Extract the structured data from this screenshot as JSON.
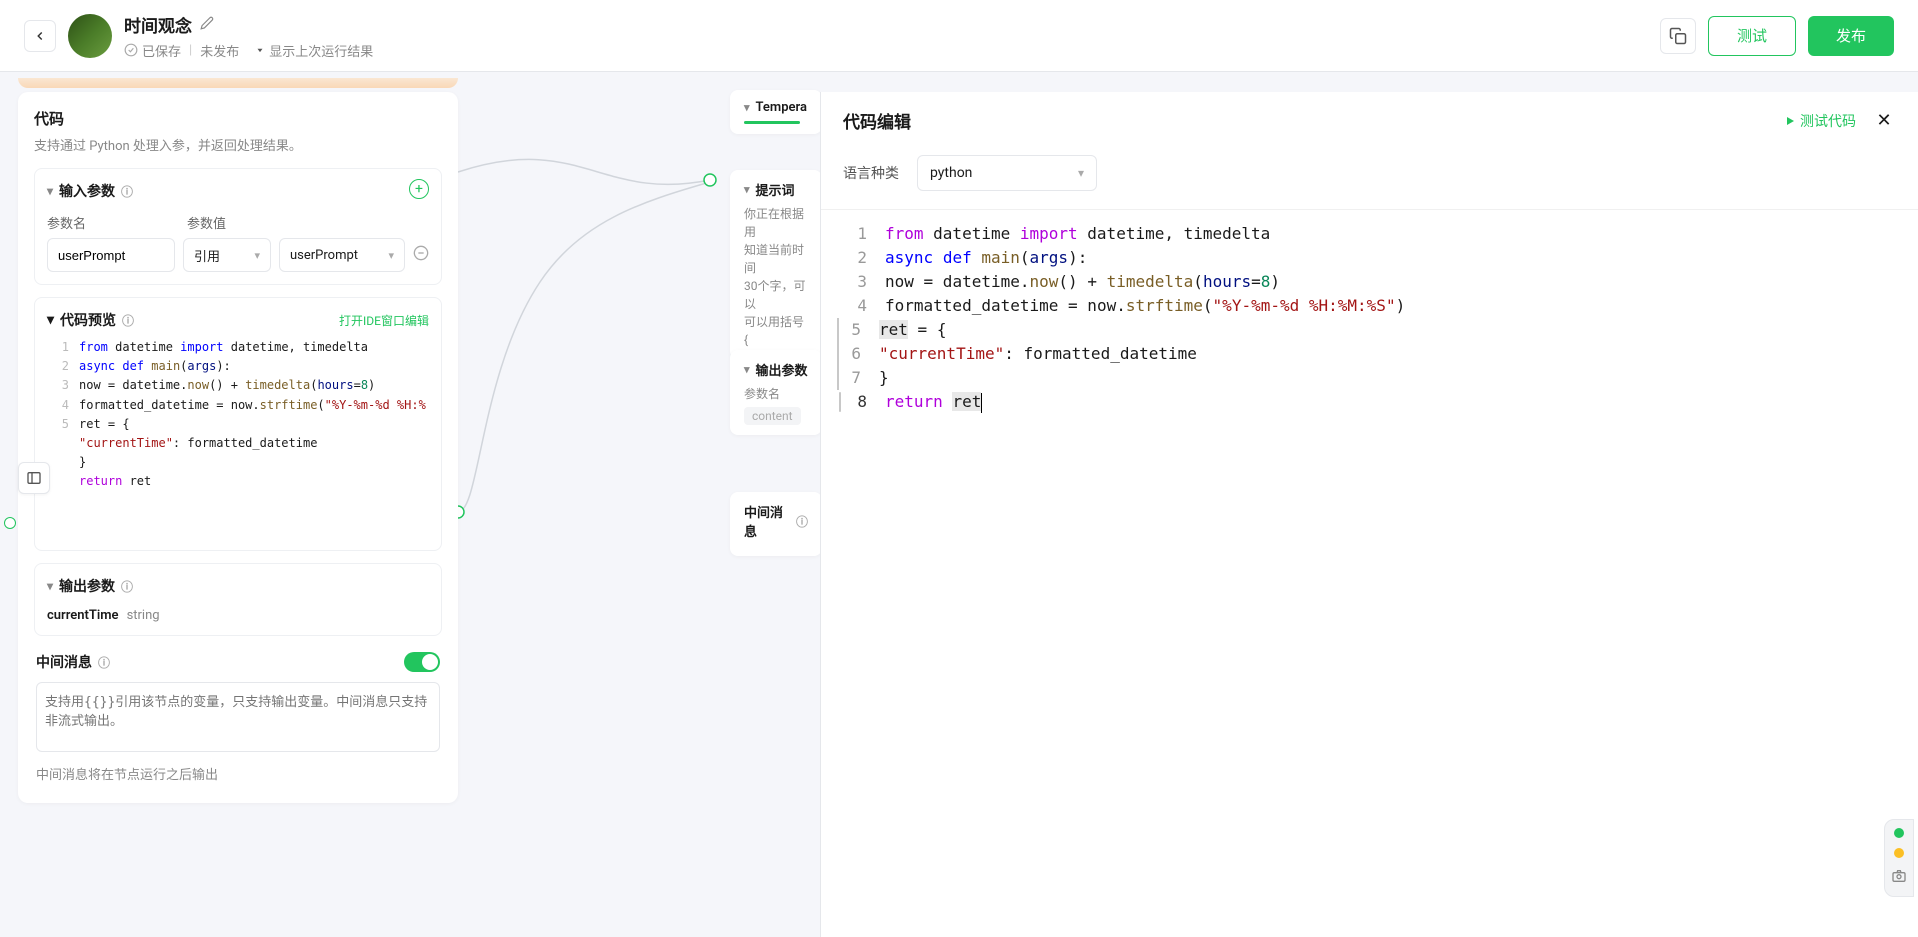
{
  "header": {
    "title": "时间观念",
    "saved": "已保存",
    "unpublished": "未发布",
    "run_dropdown": "显示上次运行结果",
    "test_btn": "测试",
    "publish_btn": "发布"
  },
  "node": {
    "title": "代码",
    "desc": "支持通过 Python 处理入参，并返回处理结果。",
    "input": {
      "section_title": "输入参数",
      "col_name": "参数名",
      "col_value": "参数值",
      "param_name": "userPrompt",
      "ref_type": "引用",
      "ref_value": "userPrompt"
    },
    "preview": {
      "title": "代码预览",
      "open_ide": "打开IDE窗口编辑"
    },
    "output": {
      "section_title": "输出参数",
      "param_name": "currentTime",
      "param_type": "string"
    },
    "mid_msg": {
      "title": "中间消息",
      "placeholder": "支持用{{}}引用该节点的变量，只支持输出变量。中间消息只支持非流式输出。",
      "hint": "中间消息将在节点运行之后输出"
    }
  },
  "mid_nodes": {
    "temp_title": "Tempera",
    "prompt_title": "提示词",
    "prompt_body": "你正在根据用\n知道当前时间\n30个字，可以\n可以用括号{",
    "out_title": "输出参数",
    "out_label": "参数名",
    "out_pill": "content",
    "midmsg_title": "中间消息"
  },
  "preview_code": {
    "lines": [
      [
        {
          "t": "from",
          "c": "kw"
        },
        {
          "t": " datetime ",
          "c": ""
        },
        {
          "t": "import",
          "c": "kw"
        },
        {
          "t": " datetime, timedelta",
          "c": ""
        }
      ],
      [
        {
          "t": "async def",
          "c": "kw"
        },
        {
          "t": " ",
          "c": ""
        },
        {
          "t": "main",
          "c": "fn"
        },
        {
          "t": "(",
          "c": ""
        },
        {
          "t": "args",
          "c": "id"
        },
        {
          "t": "):",
          "c": ""
        }
      ],
      [
        {
          "t": "    now = datetime.",
          "c": ""
        },
        {
          "t": "now",
          "c": "fn"
        },
        {
          "t": "() + ",
          "c": ""
        },
        {
          "t": "timedelta",
          "c": "fn"
        },
        {
          "t": "(",
          "c": ""
        },
        {
          "t": "hours",
          "c": "id"
        },
        {
          "t": "=",
          "c": ""
        },
        {
          "t": "8",
          "c": "num"
        },
        {
          "t": ")",
          "c": ""
        }
      ],
      [
        {
          "t": "    formatted_datetime = now.",
          "c": ""
        },
        {
          "t": "strftime",
          "c": "fn"
        },
        {
          "t": "(",
          "c": ""
        },
        {
          "t": "\"%Y-%m-%d %H:%",
          "c": "str"
        }
      ],
      [
        {
          "t": "    ret = {",
          "c": ""
        }
      ],
      [
        {
          "t": "        ",
          "c": ""
        },
        {
          "t": "\"currentTime\"",
          "c": "str"
        },
        {
          "t": ": formatted_datetime",
          "c": ""
        }
      ],
      [
        {
          "t": "    }",
          "c": ""
        }
      ],
      [
        {
          "t": "    ",
          "c": ""
        },
        {
          "t": "return",
          "c": "kw2"
        },
        {
          "t": " ret",
          "c": ""
        }
      ]
    ]
  },
  "editor": {
    "title": "代码编辑",
    "test_link": "测试代码",
    "lang_label": "语言种类",
    "lang_value": "python"
  },
  "editor_code": {
    "lines": [
      {
        "sel": false,
        "tokens": [
          {
            "t": "from",
            "c": "kw2"
          },
          {
            "t": " datetime ",
            "c": ""
          },
          {
            "t": "import",
            "c": "kw2"
          },
          {
            "t": " datetime, timedelta",
            "c": ""
          }
        ]
      },
      {
        "sel": false,
        "tokens": [
          {
            "t": "async",
            "c": "kw"
          },
          {
            "t": " ",
            "c": ""
          },
          {
            "t": "def",
            "c": "kw"
          },
          {
            "t": " ",
            "c": ""
          },
          {
            "t": "main",
            "c": "fn"
          },
          {
            "t": "(",
            "c": ""
          },
          {
            "t": "args",
            "c": "id"
          },
          {
            "t": "):",
            "c": ""
          }
        ]
      },
      {
        "sel": false,
        "tokens": [
          {
            "t": "    now ",
            "c": ""
          },
          {
            "t": "=",
            "c": ""
          },
          {
            "t": " datetime.",
            "c": ""
          },
          {
            "t": "now",
            "c": "fn"
          },
          {
            "t": "() ",
            "c": ""
          },
          {
            "t": "+",
            "c": ""
          },
          {
            "t": " ",
            "c": ""
          },
          {
            "t": "timedelta",
            "c": "fn"
          },
          {
            "t": "(",
            "c": ""
          },
          {
            "t": "hours",
            "c": "id"
          },
          {
            "t": "=",
            "c": ""
          },
          {
            "t": "8",
            "c": "num"
          },
          {
            "t": ")",
            "c": ""
          }
        ]
      },
      {
        "sel": false,
        "tokens": [
          {
            "t": "    formatted_datetime ",
            "c": ""
          },
          {
            "t": "=",
            "c": ""
          },
          {
            "t": " now.",
            "c": ""
          },
          {
            "t": "strftime",
            "c": "fn"
          },
          {
            "t": "(",
            "c": ""
          },
          {
            "t": "\"%Y-%m-%d %H:%M:%S\"",
            "c": "str"
          },
          {
            "t": ")",
            "c": ""
          }
        ]
      },
      {
        "sel": true,
        "tokens": [
          {
            "t": "    ",
            "c": ""
          },
          {
            "t": "ret",
            "c": "",
            "hl": true
          },
          {
            "t": " ",
            "c": ""
          },
          {
            "t": "=",
            "c": ""
          },
          {
            "t": " {",
            "c": ""
          }
        ]
      },
      {
        "sel": true,
        "tokens": [
          {
            "t": "        ",
            "c": ""
          },
          {
            "t": "\"currentTime\"",
            "c": "str"
          },
          {
            "t": ": formatted_datetime",
            "c": ""
          }
        ]
      },
      {
        "sel": true,
        "tokens": [
          {
            "t": "    }",
            "c": ""
          }
        ]
      },
      {
        "sel": false,
        "cur": true,
        "tokens": [
          {
            "t": "    ",
            "c": ""
          },
          {
            "t": "return",
            "c": "kw2"
          },
          {
            "t": " ",
            "c": ""
          },
          {
            "t": "ret",
            "c": "",
            "hl": true
          }
        ]
      }
    ]
  }
}
